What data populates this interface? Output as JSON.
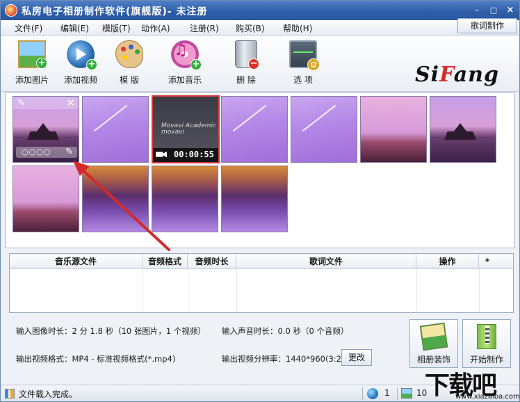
{
  "window": {
    "title": "私房电子相册制作软件(旗舰版)- 未注册",
    "controls": {
      "minimize": "–",
      "maximize": "□",
      "close": "×"
    }
  },
  "menu": {
    "items": [
      "文件(F)",
      "编辑(E)",
      "模版(T)",
      "动作(A)",
      "注册(R)",
      "购买(B)",
      "帮助(H)"
    ],
    "lyric_button": "歌词制作"
  },
  "toolbar": {
    "items": [
      {
        "label": "添加图片",
        "icon": "add-image-icon"
      },
      {
        "label": "添加视频",
        "icon": "add-video-icon"
      },
      {
        "label": "模 版",
        "icon": "palette-icon"
      },
      {
        "label": "添加音乐",
        "icon": "add-music-icon"
      },
      {
        "label": "删 除",
        "icon": "trash-icon"
      },
      {
        "label": "选 项",
        "icon": "options-icon"
      }
    ],
    "logo_part1": "Si",
    "logo_part2": "F",
    "logo_part3": "ang"
  },
  "grid": {
    "video_overlay_text": "Movavi Academic",
    "video_overlay_text2": "movavi",
    "video_duration": "00:00:55",
    "hover_dots": "○○○○"
  },
  "music_table": {
    "columns": [
      "音乐源文件",
      "音频格式",
      "音频时长",
      "歌词文件",
      "操作",
      "*"
    ]
  },
  "info": {
    "image_duration": "输入图像时长：2 分 1.8 秒（10 张图片，1 个视频）",
    "audio_duration": "输入声音时长：0.0 秒（0 个音频）",
    "output_format": "输出视频格式：MP4 - 标准视频格式(*.mp4)",
    "output_resolution": "输出视频分辨率：1440*960(3:2)",
    "change_button": "更改",
    "decorate_button": "相册装饰",
    "start_button": "开始制作"
  },
  "status": {
    "text": "文件载入完成。",
    "count1": "1",
    "count2": "10"
  },
  "watermark": {
    "main": "下载吧",
    "sub": "www.xiazaiba.com"
  },
  "colors": {
    "titlebar": "#2f5fa8",
    "selection": "#d83a3a",
    "arrow": "#d42a2a",
    "logo_accent": "#d42a2a"
  }
}
